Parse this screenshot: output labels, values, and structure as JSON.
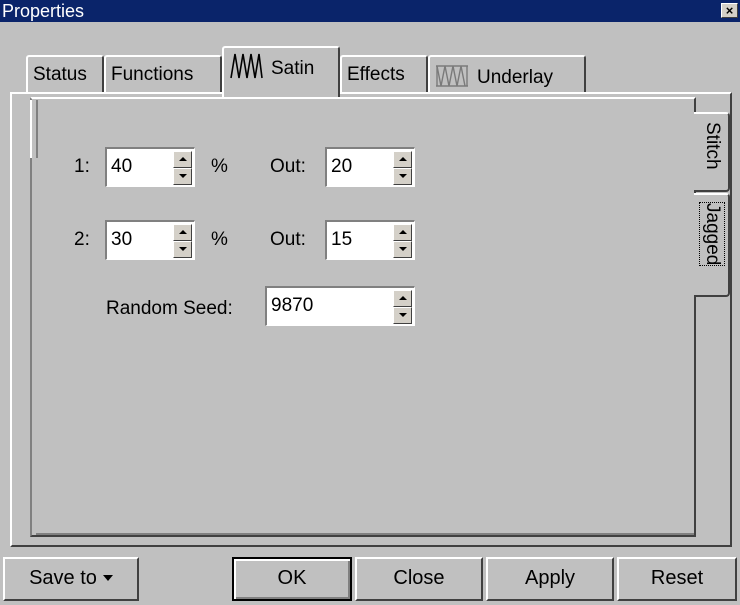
{
  "window": {
    "title": "Properties",
    "close_symbol": "×"
  },
  "tabs": [
    {
      "label": "Status",
      "active": false
    },
    {
      "label": "Functions",
      "active": false
    },
    {
      "label": "Satin",
      "active": true,
      "icon": "satin-zigzag-icon"
    },
    {
      "label": "Effects",
      "active": false
    },
    {
      "label": "Underlay",
      "active": false,
      "icon": "underlay-icon"
    }
  ],
  "side_tabs": [
    {
      "label": "Stitch",
      "active": false
    },
    {
      "label": "Jagged",
      "active": true
    }
  ],
  "form": {
    "row1": {
      "label": "1:",
      "value": "40",
      "unit": "%",
      "out_label": "Out:",
      "out_value": "20"
    },
    "row2": {
      "label": "2:",
      "value": "30",
      "unit": "%",
      "out_label": "Out:",
      "out_value": "15"
    },
    "seed": {
      "label": "Random Seed:",
      "value": "9870"
    }
  },
  "buttons": {
    "save_to": "Save to",
    "ok": "OK",
    "close": "Close",
    "apply": "Apply",
    "reset": "Reset"
  },
  "colors": {
    "titlebar": "#0a246a",
    "face": "#c0c0c0"
  }
}
